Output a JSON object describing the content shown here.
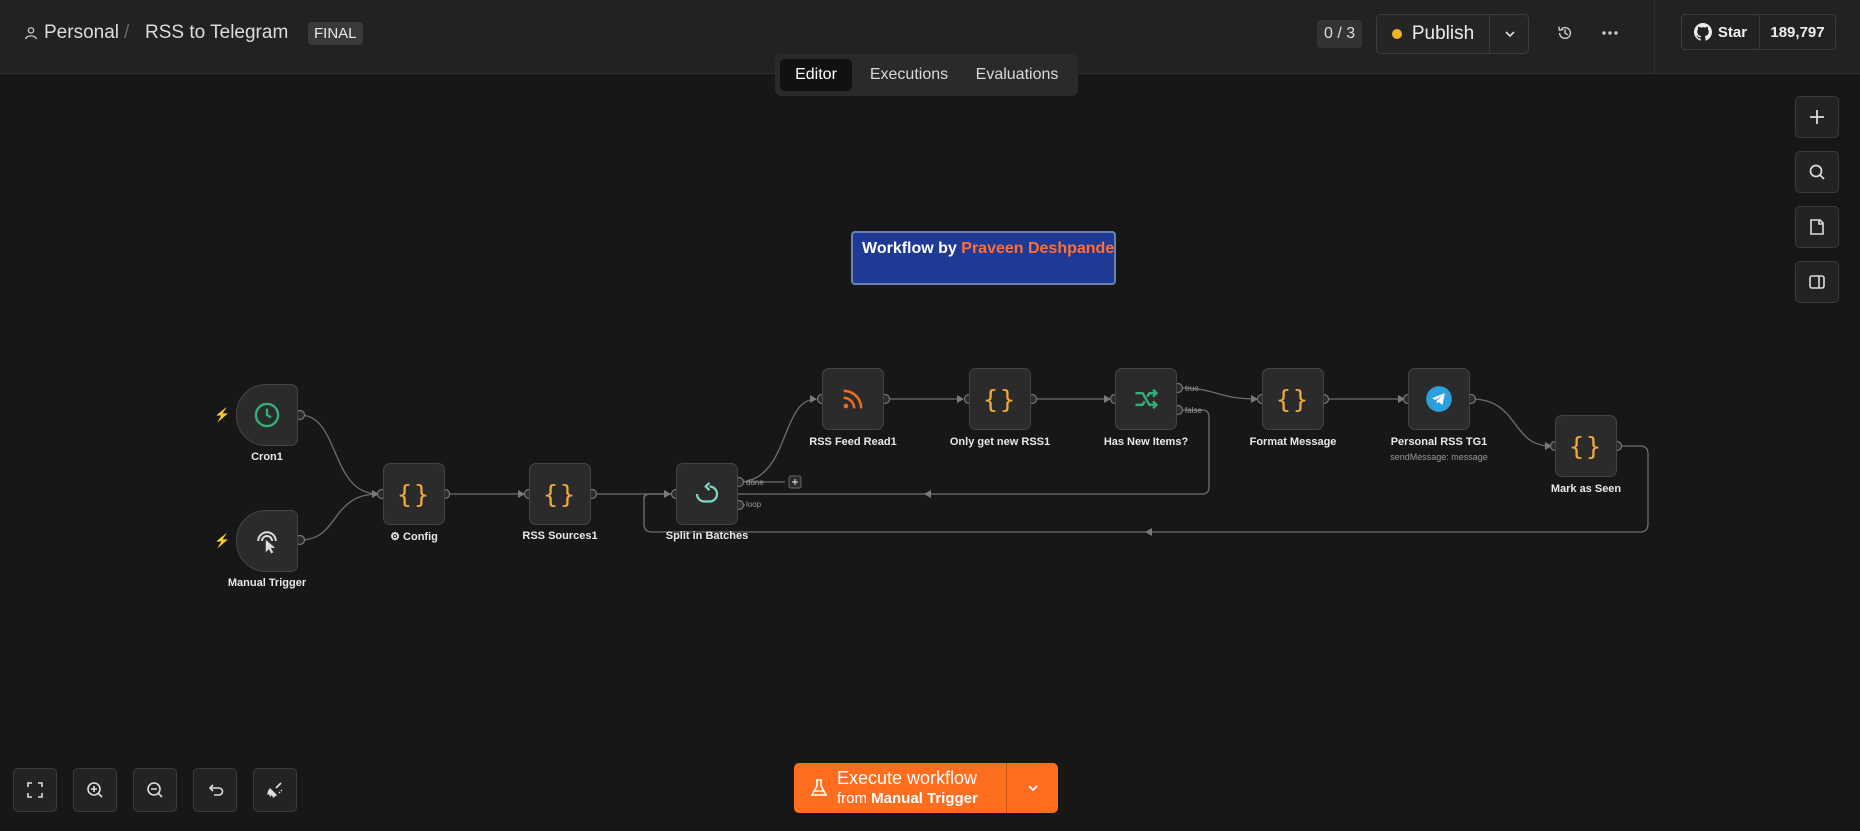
{
  "header": {
    "breadcrumb_project": "Personal",
    "breadcrumb_workflow": "RSS to Telegram",
    "tag": "FINAL",
    "counter": "0 / 3",
    "publish_label": "Publish",
    "github_star_label": "Star",
    "github_star_count": "189,797"
  },
  "tabs": [
    {
      "label": "Editor",
      "active": true
    },
    {
      "label": "Executions",
      "active": false
    },
    {
      "label": "Evaluations",
      "active": false
    }
  ],
  "sticky_note": {
    "prefix": "Workflow by ",
    "author": "Praveen Deshpande",
    "background": "#1f3a95",
    "author_color": "#ff6d38"
  },
  "nodes": {
    "cron": {
      "label": "Cron1",
      "icon": "clock-icon"
    },
    "manual_trigger": {
      "label": "Manual Trigger",
      "icon": "cursor-click-icon"
    },
    "config": {
      "label": "Config",
      "icon": "code-braces-icon"
    },
    "rss_sources": {
      "label": "RSS Sources1",
      "icon": "code-braces-icon"
    },
    "split_in_batches": {
      "label": "Split in Batches",
      "icon": "loop-icon",
      "output_done": "done",
      "output_loop": "loop"
    },
    "rss_feed_read": {
      "label": "RSS Feed Read1",
      "icon": "rss-icon"
    },
    "only_get_new": {
      "label": "Only get new RSS1",
      "icon": "code-braces-icon"
    },
    "has_new_items": {
      "label": "Has New Items?",
      "icon": "if-branch-icon",
      "output_true": "true",
      "output_false": "false"
    },
    "format_message": {
      "label": "Format Message",
      "icon": "code-braces-icon"
    },
    "telegram": {
      "label": "Personal RSS TG1",
      "subtitle": "sendMessage: message",
      "icon": "telegram-icon"
    },
    "mark_as_seen": {
      "label": "Mark as Seen",
      "icon": "code-braces-icon"
    }
  },
  "execute": {
    "label": "Execute workflow",
    "sub_prefix": "from ",
    "sub_target": "Manual Trigger"
  },
  "colors": {
    "accent": "#ff6d1f",
    "canvas": "#171717",
    "publish_dot": "#f2b424",
    "code_icon": "#f2a93b",
    "cron_icon": "#35b07a",
    "if_icon": "#35b07a",
    "loop_icon": "#7fd8c4",
    "telegram": "#2aa0dd"
  }
}
